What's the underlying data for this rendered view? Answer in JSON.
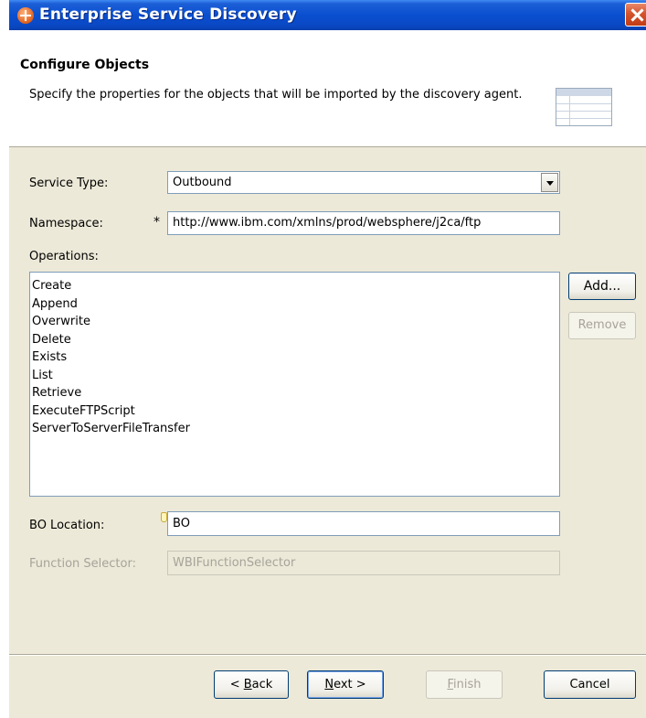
{
  "window": {
    "title": "Enterprise Service Discovery"
  },
  "banner": {
    "title": "Configure Objects",
    "description": "Specify the properties for the objects that will be imported by the discovery agent."
  },
  "form": {
    "service_type": {
      "label": "Service Type:",
      "value": "Outbound"
    },
    "namespace": {
      "label": "Namespace:",
      "required_marker": "*",
      "value": "http://www.ibm.com/xmlns/prod/websphere/j2ca/ftp"
    },
    "operations": {
      "label": "Operations:",
      "items": [
        "Create",
        "Append",
        "Overwrite",
        "Delete",
        "Exists",
        "List",
        "Retrieve",
        "ExecuteFTPScript",
        "ServerToServerFileTransfer"
      ]
    },
    "add_button": "Add...",
    "remove_button": "Remove",
    "bo_location": {
      "label": "BO Location:",
      "value": "BO"
    },
    "function_selector": {
      "label": "Function Selector:",
      "value": "WBIFunctionSelector"
    }
  },
  "footer": {
    "back": {
      "mnemonic": "B",
      "rest": "ack",
      "prefix": "< "
    },
    "next": {
      "mnemonic": "N",
      "rest": "ext",
      "suffix": " >"
    },
    "finish": {
      "mnemonic": "F",
      "rest": "inish"
    },
    "cancel": "Cancel"
  },
  "colors": {
    "titlebar": "#0a4fd0",
    "dialog_bg": "#ece9d8",
    "banner_bg": "#ffffff",
    "close": "#d4542c"
  },
  "icons": {
    "app": "enterprise-discovery-icon",
    "close": "close-icon",
    "banner": "table-icon",
    "dropdown": "chevron-down-icon",
    "hint": "content-assist-icon"
  }
}
